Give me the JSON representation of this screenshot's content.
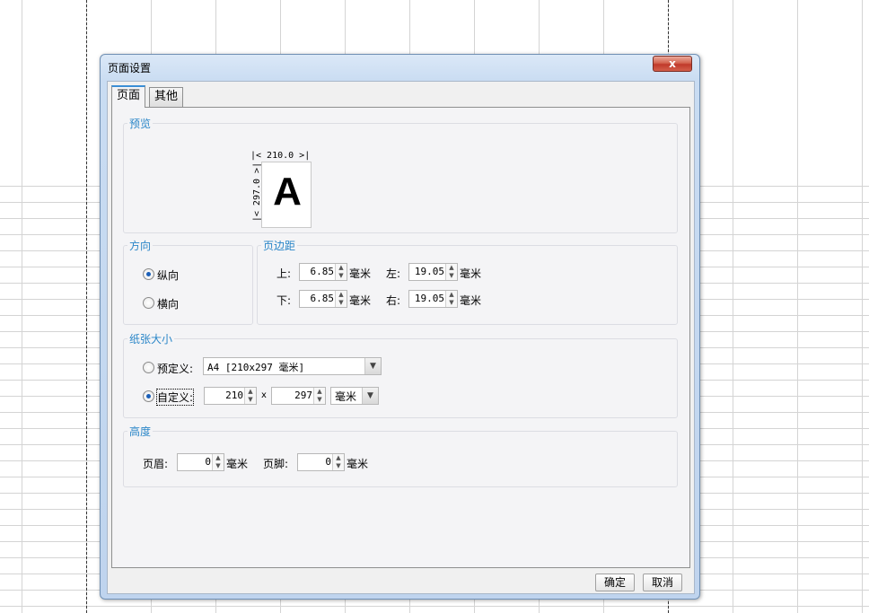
{
  "dialog": {
    "title": "页面设置",
    "close_label": "x",
    "tabs": [
      {
        "label": "页面",
        "active": true
      },
      {
        "label": "其他",
        "active": false
      }
    ],
    "preview": {
      "legend": "预览",
      "paper_letter": "A",
      "width_label": "|< 210.0 >|",
      "height_label": "|< 297.0 >|"
    },
    "orientation": {
      "legend": "方向",
      "portrait": "纵向",
      "landscape": "横向",
      "selected": "portrait"
    },
    "margins": {
      "legend": "页边距",
      "top_label": "上:",
      "top_value": "6.85",
      "left_label": "左:",
      "left_value": "19.05",
      "bottom_label": "下:",
      "bottom_value": "6.85",
      "right_label": "右:",
      "right_value": "19.05",
      "unit": "毫米"
    },
    "paper_size": {
      "legend": "纸张大小",
      "predefined_label": "预定义:",
      "predefined_value": "A4 [210x297 毫米]",
      "custom_label": "自定义:",
      "custom_width": "210",
      "times": "x",
      "custom_height": "297",
      "unit_value": "毫米",
      "selected": "custom"
    },
    "height": {
      "legend": "高度",
      "header_label": "页眉:",
      "header_value": "0",
      "footer_label": "页脚:",
      "footer_value": "0",
      "unit": "毫米"
    },
    "buttons": {
      "ok": "确定",
      "cancel": "取消"
    }
  }
}
